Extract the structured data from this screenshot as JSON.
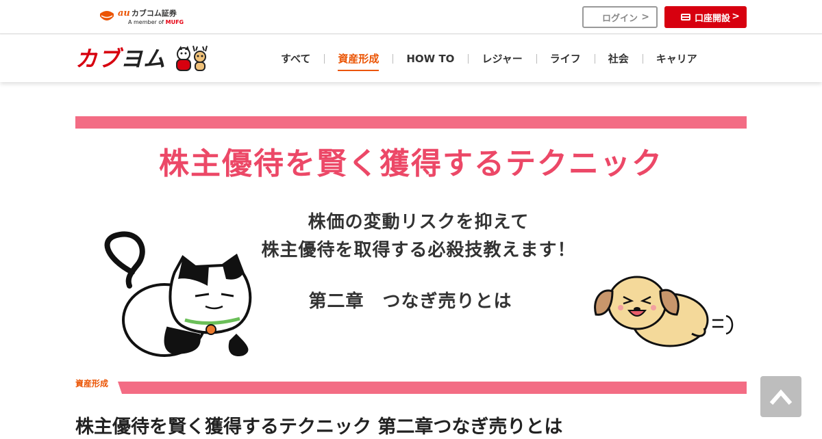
{
  "header": {
    "au_logo": {
      "au": "au",
      "name": "カブコム証券",
      "sub": "A member of",
      "mufg": "MUFG"
    },
    "login_label": "ログイン",
    "open_account_label": "口座開設"
  },
  "nav": {
    "logo_text_first": "カブ",
    "logo_text_rest": "ヨム",
    "items": [
      {
        "label": "すべて"
      },
      {
        "label": "資産形成"
      },
      {
        "label": "HOW TO"
      },
      {
        "label": "レジャー"
      },
      {
        "label": "ライフ"
      },
      {
        "label": "社会"
      },
      {
        "label": "キャリア"
      }
    ],
    "active_index": 1
  },
  "hero": {
    "title": "株主優待を賢く獲得するテクニック",
    "line1": "株価の変動リスクを抑えて",
    "line2": "株主優待を取得する必殺技教えます！",
    "line3": "第二章　つなぎ売りとは"
  },
  "article": {
    "category": "資産形成",
    "title": "株主優待を賢く獲得するテクニック 第二章つなぎ売りとは"
  },
  "colors": {
    "accent_orange": "#eb5505",
    "brand_red": "#d7000f",
    "hero_pink": "#f36c84",
    "title_pink": "#ec4867"
  },
  "icons": [
    "au-logo-icon",
    "chevron-right-icon",
    "card-icon",
    "mascot-icon",
    "cat-illustration",
    "dog-illustration",
    "arrow-up-icon"
  ]
}
